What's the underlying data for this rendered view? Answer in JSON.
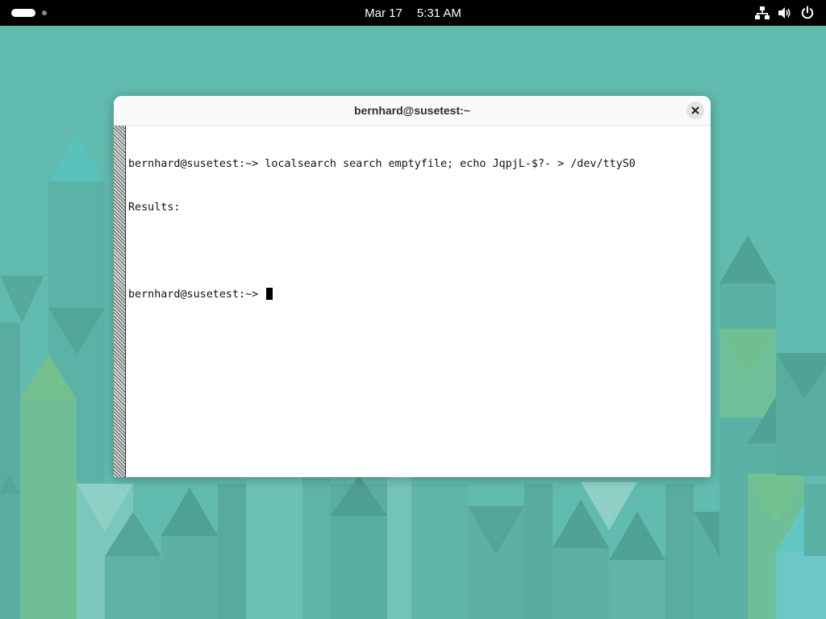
{
  "topbar": {
    "date": "Mar 17",
    "time": "5:31 AM",
    "icons": [
      "activities-indicator",
      "network-wired-icon",
      "volume-icon",
      "power-icon"
    ]
  },
  "window": {
    "title": "bernhard@susetest:~",
    "close_icon": "close-icon"
  },
  "terminal": {
    "lines": [
      "bernhard@susetest:~> localsearch search emptyfile; echo JqpjL-$?- > /dev/ttyS0",
      "Results:",
      "",
      "bernhard@susetest:~> "
    ]
  },
  "colors": {
    "wallpaper": "#5fb8aa",
    "topbar": "#000000",
    "window_bg": "#ffffff",
    "titlebar": "#fafafa",
    "text": "#111111"
  }
}
